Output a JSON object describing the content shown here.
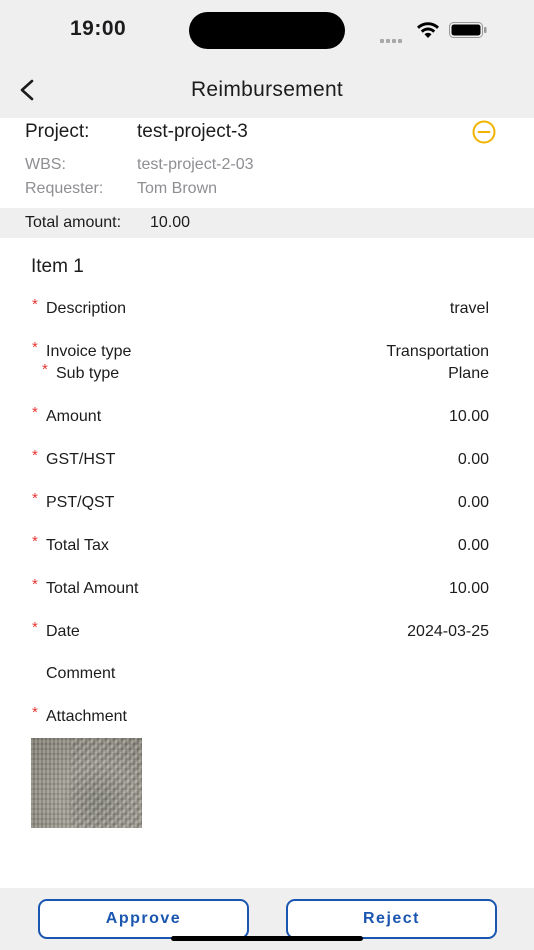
{
  "status_bar": {
    "time": "19:00"
  },
  "nav": {
    "title": "Reimbursement",
    "back_icon": "chevron-left-icon"
  },
  "header": {
    "project_label": "Project:",
    "project_value": "test-project-3",
    "wbs_label": "WBS:",
    "wbs_value": "test-project-2-03",
    "requester_label": "Requester:",
    "requester_value": "Tom Brown",
    "remove_icon": "minus-circle-icon",
    "accent_color": "#f0b400"
  },
  "total": {
    "label": "Total amount:",
    "value": "10.00"
  },
  "item": {
    "title": "Item 1",
    "fields": [
      {
        "label": "Description",
        "value": "travel",
        "required": true
      },
      {
        "label": "Invoice type",
        "value": "Transportation",
        "required": true
      },
      {
        "label": "Sub type",
        "value": "Plane",
        "required": true
      },
      {
        "label": "Amount",
        "value": "10.00",
        "required": true
      },
      {
        "label": "GST/HST",
        "value": "0.00",
        "required": true
      },
      {
        "label": "PST/QST",
        "value": "0.00",
        "required": true
      },
      {
        "label": "Total Tax",
        "value": "0.00",
        "required": true
      },
      {
        "label": "Total Amount",
        "value": "10.00",
        "required": true
      },
      {
        "label": "Date",
        "value": "2024-03-25",
        "required": true
      },
      {
        "label": "Comment",
        "value": "",
        "required": false
      },
      {
        "label": "Attachment",
        "value": "",
        "required": true
      }
    ],
    "required_marker": "*"
  },
  "actions": {
    "approve_label": "Approve",
    "reject_label": "Reject",
    "button_color": "#1a56b0"
  }
}
